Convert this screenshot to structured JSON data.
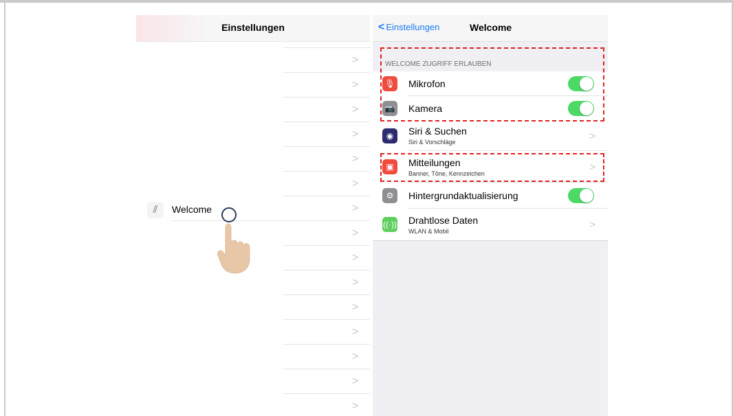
{
  "left_screen": {
    "title": "Einstellungen",
    "welcome_label": "Welcome",
    "chevron": ">"
  },
  "right_screen": {
    "back_label": "Einstellungen",
    "back_chevron": "<",
    "title": "Welcome",
    "section_header": "WELCOME ZUGRIFF ERLAUBEN",
    "rows": [
      {
        "title": "Mikrofon",
        "icon": "microphone-icon",
        "icon_color": "#ef4b3f",
        "toggle_on": true
      },
      {
        "title": "Kamera",
        "icon": "camera-icon",
        "icon_color": "#8e8e93",
        "toggle_on": true
      },
      {
        "title": "Siri & Suchen",
        "subtitle": "Siri & Vorschläge",
        "icon": "siri-icon",
        "icon_color": "#2b2b6e"
      },
      {
        "title": "Mitteilungen",
        "subtitle": "Banner, Töne, Kennzeichen",
        "icon": "notifications-icon",
        "icon_color": "#ef4b3f"
      },
      {
        "title": "Hintergrundaktualisierung",
        "icon": "gear-icon",
        "icon_color": "#8e8e93",
        "toggle_on": true
      },
      {
        "title": "Drahtlose Daten",
        "subtitle": "WLAN & Mobil",
        "icon": "antenna-icon",
        "icon_color": "#5ccf5c"
      }
    ]
  },
  "colors": {
    "accent": "#1a7cf5",
    "toggle_on": "#4cd964",
    "highlight": "#e02020"
  }
}
